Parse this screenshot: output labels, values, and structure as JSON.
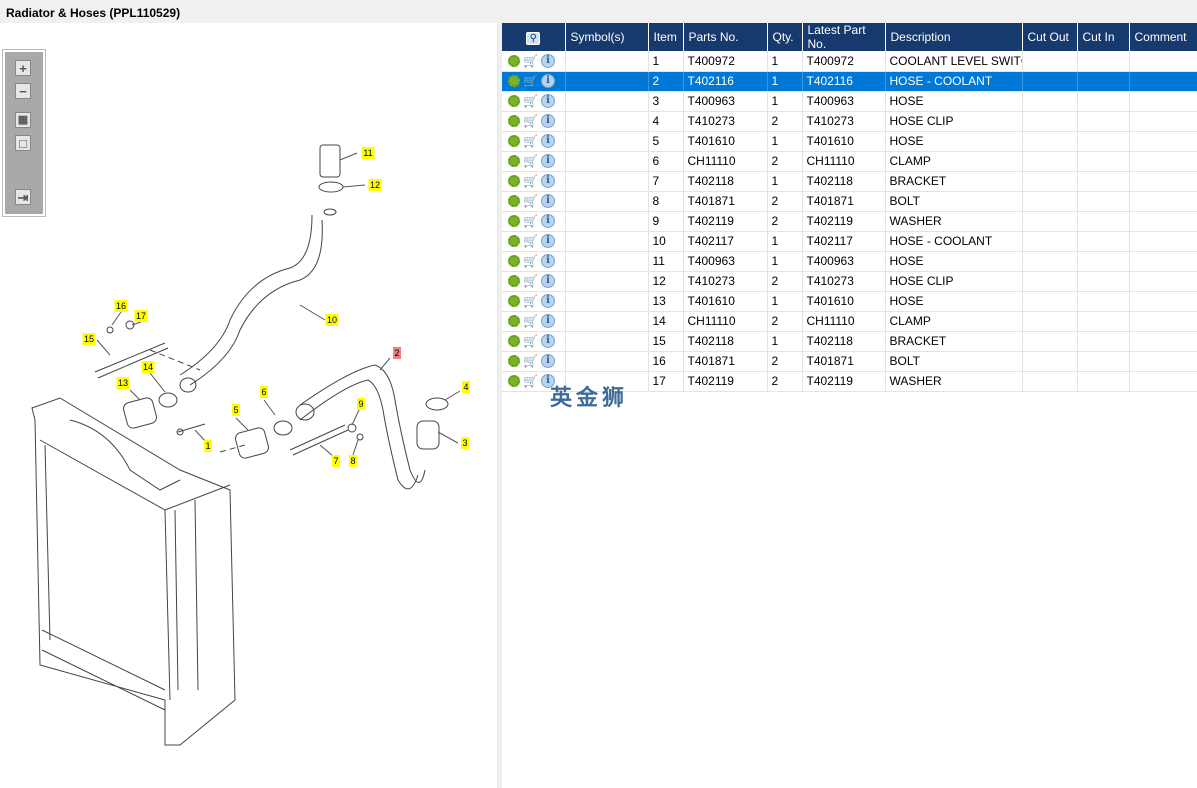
{
  "title": "Radiator & Hoses (PPL110529)",
  "toolbar": {
    "zoom_in": "+",
    "zoom_out": "−",
    "fit": "▦",
    "actual": "□",
    "toggle": "⇥"
  },
  "table": {
    "headers": [
      "",
      "Symbol(s)",
      "Item",
      "Parts No.",
      "Qty.",
      "Latest Part No.",
      "Description",
      "Cut Out",
      "Cut In",
      "Comment"
    ],
    "selected_item": "2",
    "rows": [
      {
        "item": "1",
        "part": "T400972",
        "qty": "1",
        "latest": "T400972",
        "desc": "COOLANT LEVEL SWITCH"
      },
      {
        "item": "2",
        "part": "T402116",
        "qty": "1",
        "latest": "T402116",
        "desc": "HOSE - COOLANT"
      },
      {
        "item": "3",
        "part": "T400963",
        "qty": "1",
        "latest": "T400963",
        "desc": "HOSE"
      },
      {
        "item": "4",
        "part": "T410273",
        "qty": "2",
        "latest": "T410273",
        "desc": "HOSE CLIP"
      },
      {
        "item": "5",
        "part": "T401610",
        "qty": "1",
        "latest": "T401610",
        "desc": "HOSE"
      },
      {
        "item": "6",
        "part": "CH11110",
        "qty": "2",
        "latest": "CH11110",
        "desc": "CLAMP"
      },
      {
        "item": "7",
        "part": "T402118",
        "qty": "1",
        "latest": "T402118",
        "desc": "BRACKET"
      },
      {
        "item": "8",
        "part": "T401871",
        "qty": "2",
        "latest": "T401871",
        "desc": "BOLT"
      },
      {
        "item": "9",
        "part": "T402119",
        "qty": "2",
        "latest": "T402119",
        "desc": "WASHER"
      },
      {
        "item": "10",
        "part": "T402117",
        "qty": "1",
        "latest": "T402117",
        "desc": "HOSE - COOLANT"
      },
      {
        "item": "11",
        "part": "T400963",
        "qty": "1",
        "latest": "T400963",
        "desc": "HOSE"
      },
      {
        "item": "12",
        "part": "T410273",
        "qty": "2",
        "latest": "T410273",
        "desc": "HOSE CLIP"
      },
      {
        "item": "13",
        "part": "T401610",
        "qty": "1",
        "latest": "T401610",
        "desc": "HOSE"
      },
      {
        "item": "14",
        "part": "CH11110",
        "qty": "2",
        "latest": "CH11110",
        "desc": "CLAMP"
      },
      {
        "item": "15",
        "part": "T402118",
        "qty": "1",
        "latest": "T402118",
        "desc": "BRACKET"
      },
      {
        "item": "16",
        "part": "T401871",
        "qty": "2",
        "latest": "T401871",
        "desc": "BOLT"
      },
      {
        "item": "17",
        "part": "T402119",
        "qty": "2",
        "latest": "T402119",
        "desc": "WASHER"
      }
    ]
  },
  "callouts": [
    "1",
    "2",
    "3",
    "4",
    "5",
    "6",
    "7",
    "8",
    "9",
    "10",
    "11",
    "12",
    "13",
    "14",
    "15",
    "16",
    "17"
  ],
  "watermark": "英金狮",
  "colors": {
    "header": "#163a6e",
    "selected": "#0078d7",
    "callout": "#ffff00",
    "callout_selected": "#f08080"
  }
}
